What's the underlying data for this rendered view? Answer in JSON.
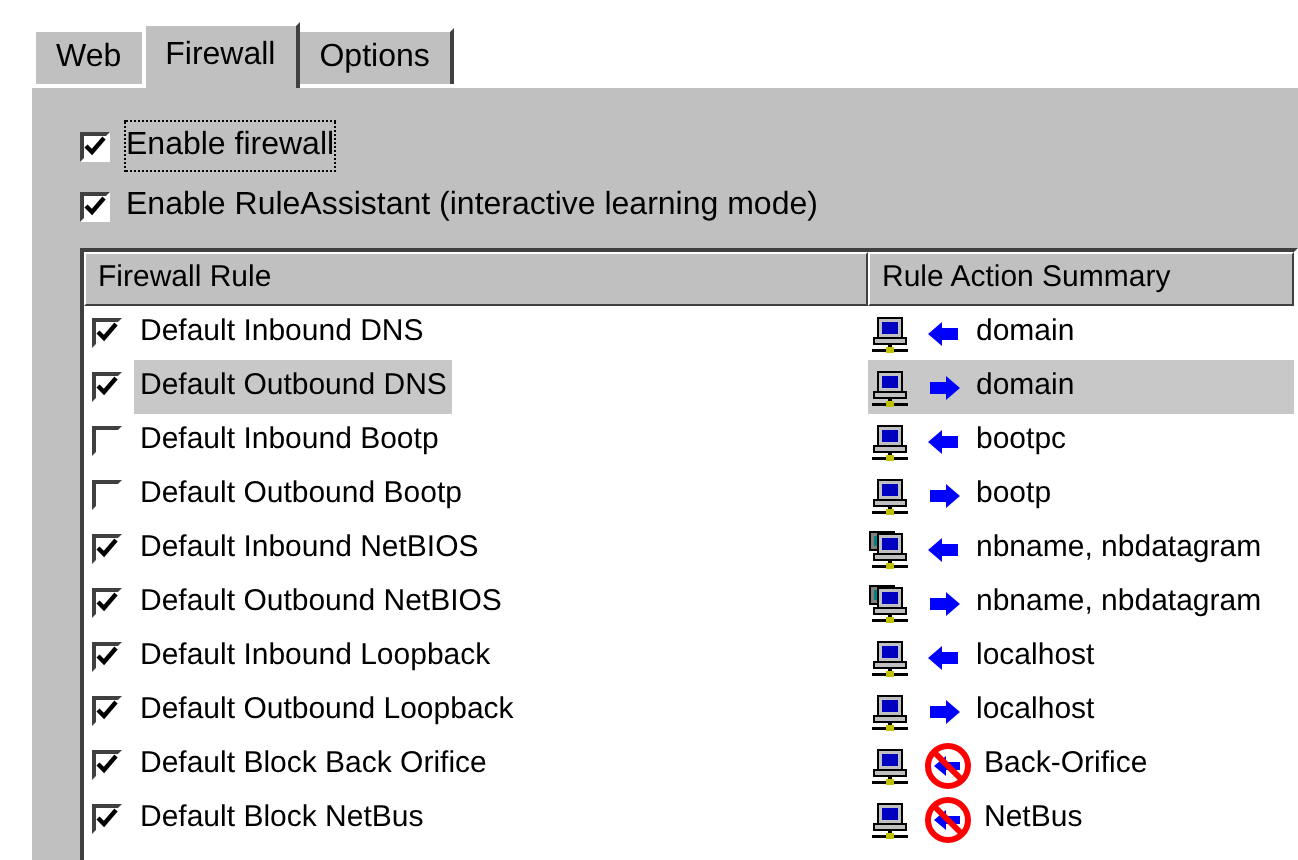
{
  "tabs": [
    {
      "label": "Web",
      "selected": false
    },
    {
      "label": "Firewall",
      "selected": true
    },
    {
      "label": "Options",
      "selected": false
    }
  ],
  "options": [
    {
      "label": "Enable firewall",
      "checked": true,
      "focused": true
    },
    {
      "label": "Enable RuleAssistant (interactive learning mode)",
      "checked": true,
      "focused": false
    }
  ],
  "table": {
    "columns": [
      "Firewall Rule",
      "Rule Action Summary"
    ],
    "rows": [
      {
        "rule": "Default Inbound DNS",
        "checked": true,
        "selected": false,
        "host": {
          "kind": "single"
        },
        "action": {
          "kind": "in"
        },
        "summary": "domain"
      },
      {
        "rule": "Default Outbound DNS",
        "checked": true,
        "selected": true,
        "host": {
          "kind": "single"
        },
        "action": {
          "kind": "out"
        },
        "summary": "domain"
      },
      {
        "rule": "Default Inbound Bootp",
        "checked": false,
        "selected": false,
        "host": {
          "kind": "single"
        },
        "action": {
          "kind": "in"
        },
        "summary": "bootpc"
      },
      {
        "rule": "Default Outbound Bootp",
        "checked": false,
        "selected": false,
        "host": {
          "kind": "single"
        },
        "action": {
          "kind": "out"
        },
        "summary": "bootp"
      },
      {
        "rule": "Default Inbound NetBIOS",
        "checked": true,
        "selected": false,
        "host": {
          "kind": "multi"
        },
        "action": {
          "kind": "in"
        },
        "summary": "nbname, nbdatagram"
      },
      {
        "rule": "Default Outbound NetBIOS",
        "checked": true,
        "selected": false,
        "host": {
          "kind": "multi"
        },
        "action": {
          "kind": "out"
        },
        "summary": "nbname, nbdatagram"
      },
      {
        "rule": "Default Inbound Loopback",
        "checked": true,
        "selected": false,
        "host": {
          "kind": "single"
        },
        "action": {
          "kind": "in"
        },
        "summary": "localhost"
      },
      {
        "rule": "Default Outbound Loopback",
        "checked": true,
        "selected": false,
        "host": {
          "kind": "single"
        },
        "action": {
          "kind": "out"
        },
        "summary": "localhost"
      },
      {
        "rule": "Default Block Back Orifice",
        "checked": true,
        "selected": false,
        "host": {
          "kind": "single"
        },
        "action": {
          "kind": "block"
        },
        "summary": "Back-Orifice"
      },
      {
        "rule": "Default Block NetBus",
        "checked": true,
        "selected": false,
        "host": {
          "kind": "single"
        },
        "action": {
          "kind": "block"
        },
        "summary": "NetBus"
      }
    ]
  }
}
